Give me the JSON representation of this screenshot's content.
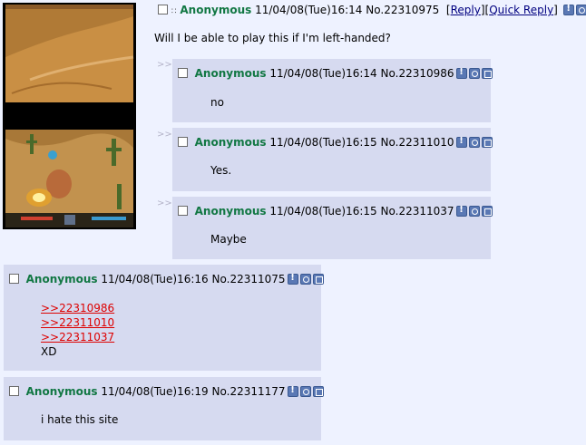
{
  "op": {
    "name": "Anonymous",
    "datetime": "11/04/08(Tue)16:14",
    "post_no": "No.22310975",
    "reply_link": "Reply",
    "quick_reply_link": "Quick Reply",
    "comment": "Will I be able to play this if I'm left-handed?"
  },
  "replies": [
    {
      "name": "Anonymous",
      "datetime": "11/04/08(Tue)16:14",
      "post_no": "No.22310986",
      "comment": "no"
    },
    {
      "name": "Anonymous",
      "datetime": "11/04/08(Tue)16:15",
      "post_no": "No.22311010",
      "comment": "Yes."
    },
    {
      "name": "Anonymous",
      "datetime": "11/04/08(Tue)16:15",
      "post_no": "No.22311037",
      "comment": "Maybe"
    },
    {
      "name": "Anonymous",
      "datetime": "11/04/08(Tue)16:16",
      "post_no": "No.22311075",
      "quotes": [
        ">>22310986",
        ">>22311010",
        ">>22311037"
      ],
      "comment": "XD"
    },
    {
      "name": "Anonymous",
      "datetime": "11/04/08(Tue)16:19",
      "post_no": "No.22311177",
      "comment": "i hate this site"
    }
  ],
  "reply_arrows": ">>",
  "icons": [
    "report-icon",
    "search-icon",
    "image-icon"
  ],
  "colors": {
    "page_bg": "#eef2ff",
    "reply_bg": "#d6daf0",
    "name": "#117743",
    "quotelink": "#dd0000"
  }
}
